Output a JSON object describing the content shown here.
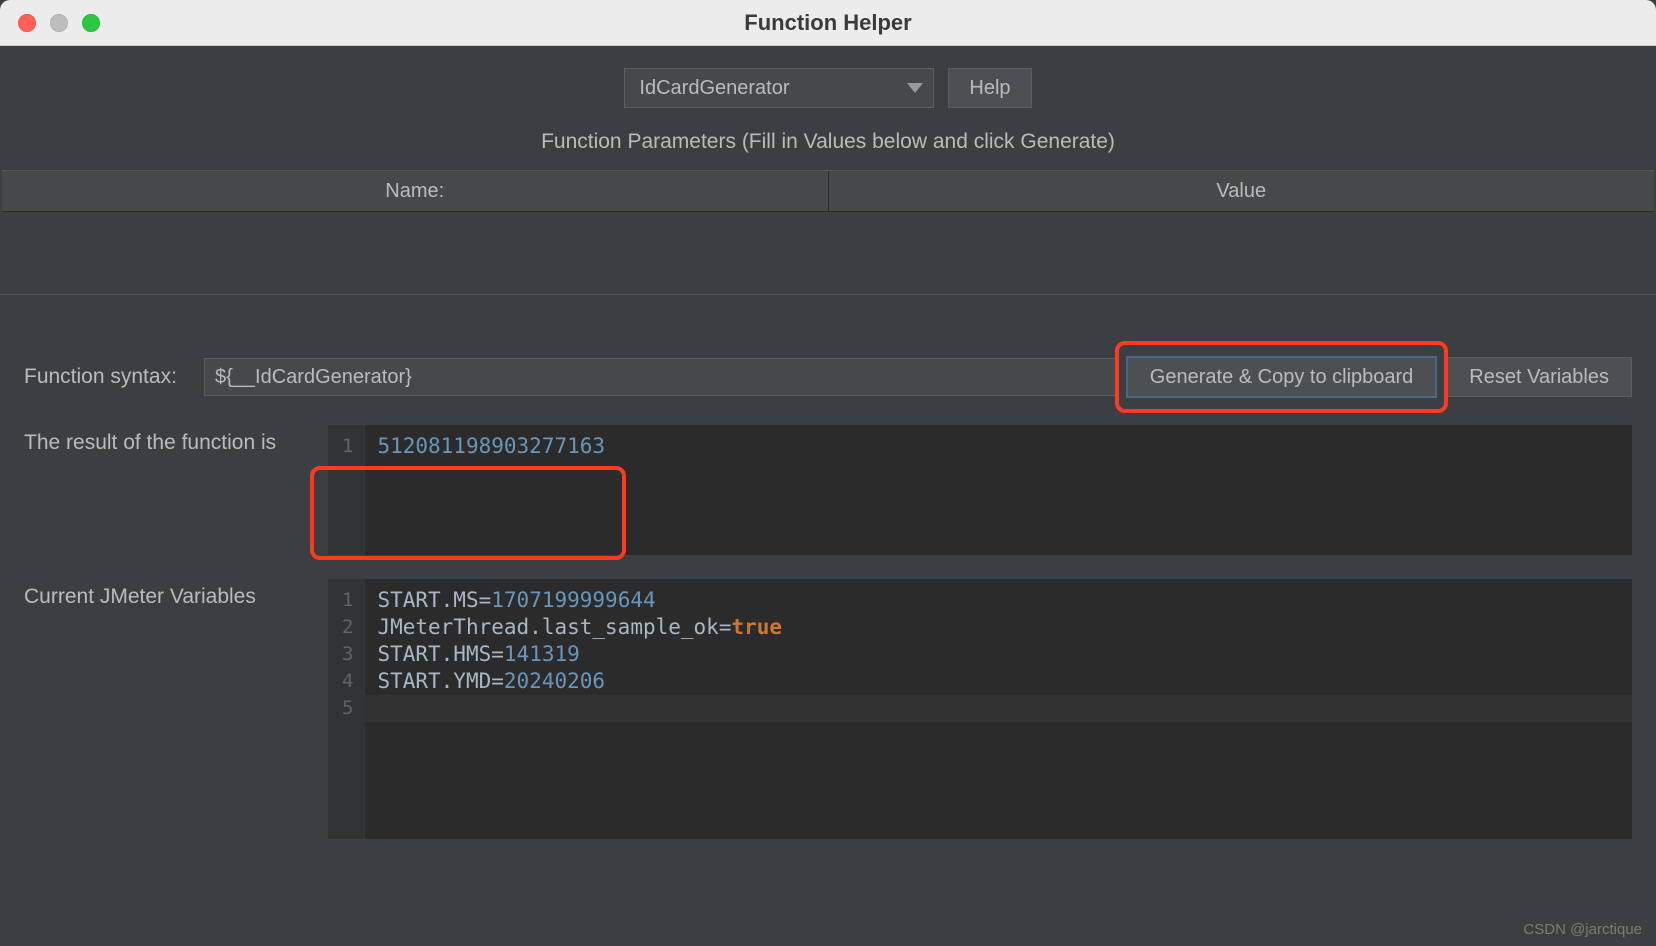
{
  "window": {
    "title": "Function Helper"
  },
  "topControls": {
    "functionSelect": "IdCardGenerator",
    "helpLabel": "Help"
  },
  "parameters": {
    "sectionLabel": "Function Parameters (Fill in Values below and click Generate)",
    "columns": {
      "name": "Name:",
      "value": "Value"
    },
    "rows": []
  },
  "syntax": {
    "label": "Function syntax:",
    "value": "${__IdCardGenerator}",
    "generateLabel": "Generate & Copy to clipboard",
    "resetLabel": "Reset Variables"
  },
  "result": {
    "label": "The result of the function is",
    "lines": [
      {
        "n": 1,
        "text": "512081198903277163",
        "type": "num"
      }
    ]
  },
  "variables": {
    "label": "Current JMeter Variables",
    "lines": [
      {
        "n": 1,
        "key": "START.MS",
        "sep": "=",
        "val": "1707199999644",
        "valType": "num"
      },
      {
        "n": 2,
        "key": "JMeterThread.last_sample_ok",
        "sep": "=",
        "val": "true",
        "valType": "kw"
      },
      {
        "n": 3,
        "key": "START.HMS",
        "sep": "=",
        "val": "141319",
        "valType": "num"
      },
      {
        "n": 4,
        "key": "START.YMD",
        "sep": "=",
        "val": "20240206",
        "valType": "num"
      },
      {
        "n": 5,
        "key": "",
        "sep": "",
        "val": "",
        "valType": "cur"
      }
    ]
  },
  "watermark": "CSDN @jarctique"
}
